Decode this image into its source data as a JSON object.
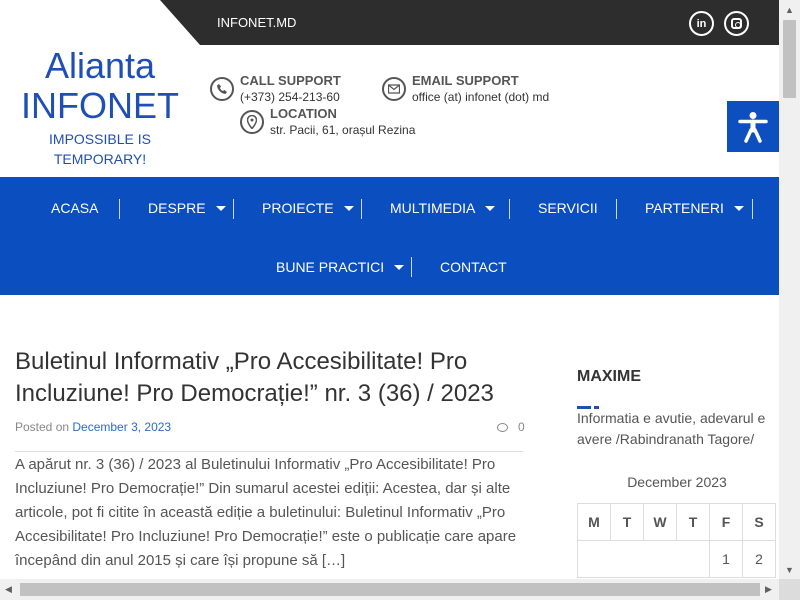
{
  "topbar": {
    "site_label": "INFONET.MD",
    "social": [
      "linkedin-icon",
      "instagram-icon"
    ],
    "linkedin_text": "in"
  },
  "logo": {
    "line1": "Alianta",
    "line2": "INFONET",
    "tagline1": "IMPOSSIBLE IS",
    "tagline2": "TEMPORARY!"
  },
  "contact": {
    "call_label": "CALL SUPPORT",
    "call_value": "(+373) 254-213-60",
    "email_label": "EMAIL SUPPORT",
    "email_value": "office (at) infonet (dot) md",
    "location_label": "LOCATION",
    "location_value": "str. Pacii, 61, orașul Rezina"
  },
  "nav": {
    "items": [
      {
        "label": "ACASA",
        "dropdown": false
      },
      {
        "label": "DESPRE",
        "dropdown": true
      },
      {
        "label": "PROIECTE",
        "dropdown": true
      },
      {
        "label": "MULTIMEDIA",
        "dropdown": true
      },
      {
        "label": "SERVICII",
        "dropdown": false
      },
      {
        "label": "PARTENERI",
        "dropdown": true
      },
      {
        "label": "BUNE PRACTICI",
        "dropdown": true
      },
      {
        "label": "CONTACT",
        "dropdown": false
      }
    ]
  },
  "post": {
    "title": "Buletinul Informativ „Pro Accesibilitate! Pro Incluziune! Pro Democrație!” nr. 3 (36) / 2023",
    "posted_on": "Posted on ",
    "date": "December 3, 2023",
    "comment_count": "0",
    "excerpt": "A apărut nr. 3 (36) / 2023 al Buletinului Informativ „Pro Accesibilitate! Pro Incluziune! Pro Democrație!” Din sumarul acestei ediții: Acestea, dar și alte articole, pot fi citite în această ediție a buletinului: Buletinul Informativ „Pro Accesibilitate! Pro Incluziune! Pro Democrație!” este o publicație care apare începând din anul 2015 și care își propune să […]"
  },
  "sidebar": {
    "title": "MAXIME",
    "quote": "Informatia e avutie, adevarul e avere /Rabindranath Tagore/",
    "calendar": {
      "caption": "December 2023",
      "weekdays": [
        "M",
        "T",
        "W",
        "T",
        "F",
        "S"
      ],
      "row1": [
        "",
        "",
        "",
        "",
        "1",
        "2"
      ]
    }
  },
  "colors": {
    "brand_blue": "#1f4fb4",
    "nav_blue": "#0b4ec0",
    "topbar": "#2d2d2d"
  }
}
